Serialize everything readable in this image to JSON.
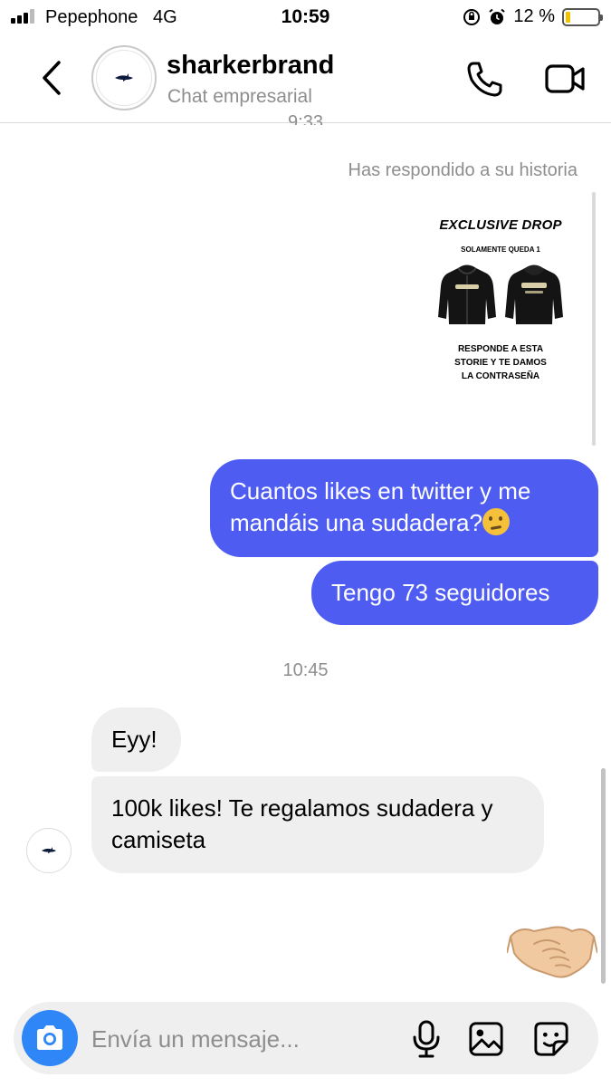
{
  "status_bar": {
    "carrier": "Pepephone",
    "network": "4G",
    "time": "10:59",
    "battery": "12 %",
    "battery_level": 0.12,
    "icons": [
      "signal-icon",
      "orientation-lock-icon",
      "alarm-icon",
      "battery-icon"
    ]
  },
  "header": {
    "name": "sharkerbrand",
    "subtitle": "Chat empresarial",
    "icons": [
      "back-chevron-icon",
      "phone-icon",
      "video-camera-icon"
    ]
  },
  "chat": {
    "partial_time": "9:33",
    "reply_note": "Has respondido a su historia",
    "story": {
      "title": "EXCLUSIVE DROP",
      "subtitle": "SOLAMENTE QUEDA 1",
      "cta_lines": [
        "RESPONDE A ESTA",
        "STORIE Y TE DAMOS",
        "LA CONTRASEÑA"
      ]
    },
    "sent_1": "Cuantos likes en twitter y me mandáis una sudadera?",
    "sent_2": "Tengo 73 seguidores",
    "time_mid": "10:45",
    "recv_1": "Eyy!",
    "recv_2": "100k likes! Te regalamos sudadera y camiseta",
    "reaction": "handshake"
  },
  "composer": {
    "placeholder": "Envía un mensaje...",
    "icons": [
      "camera-icon",
      "microphone-icon",
      "gallery-icon",
      "sticker-icon"
    ]
  },
  "colors": {
    "sent_bubble": "#4e5cf2",
    "received_bubble": "#efefef",
    "camera_button": "#2f86f6",
    "secondary_text": "#8e8e8e"
  }
}
